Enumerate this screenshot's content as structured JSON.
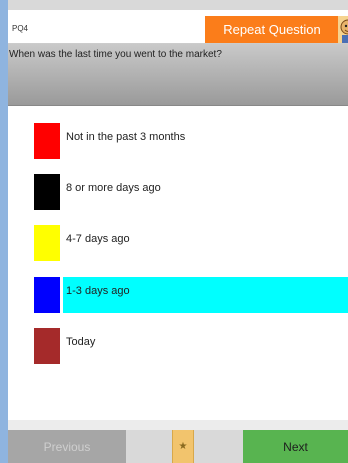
{
  "header": {
    "question_id": "PQ4",
    "repeat_label": "Repeat Question"
  },
  "question": {
    "text": "When was the last time you went to the market?"
  },
  "options": [
    {
      "label": "Not in the past 3 months",
      "color": "#ff0000",
      "selected": false
    },
    {
      "label": "8 or more days ago",
      "color": "#000000",
      "selected": false
    },
    {
      "label": "4-7 days ago",
      "color": "#ffff00",
      "selected": false
    },
    {
      "label": "1-3 days ago",
      "color": "#0000ff",
      "selected": true
    },
    {
      "label": "Today",
      "color": "#a52a2a",
      "selected": false
    }
  ],
  "highlight_color": "#00ffff",
  "footer": {
    "previous_label": "Previous",
    "star_icon": "star-icon",
    "next_label": "Next"
  }
}
